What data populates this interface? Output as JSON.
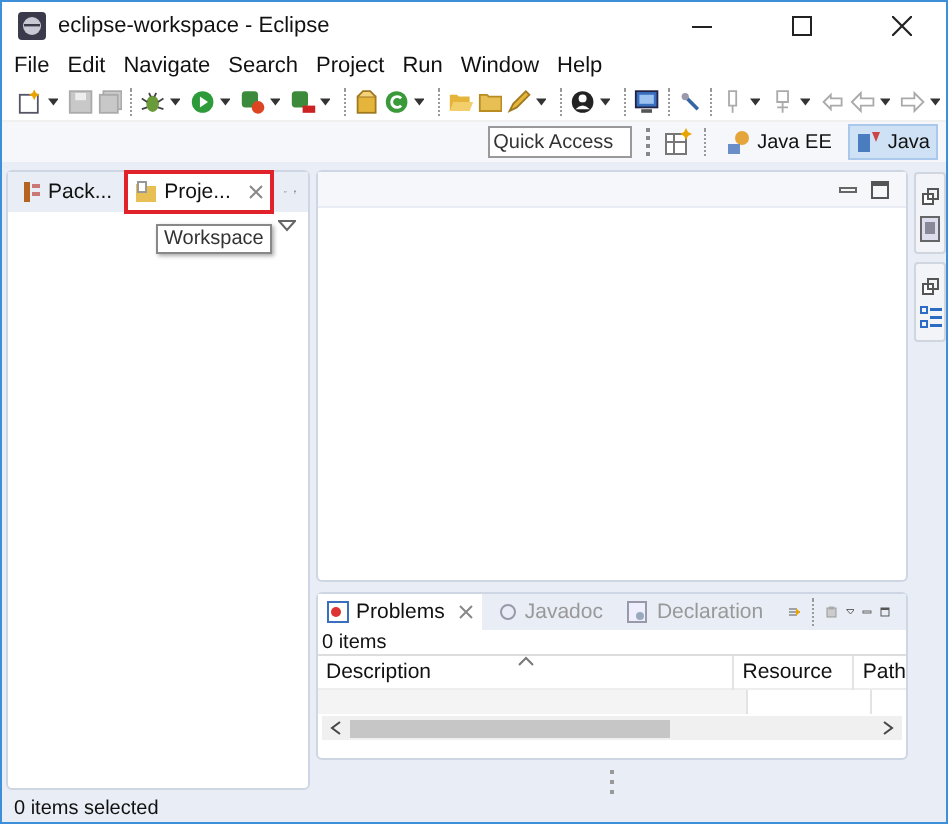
{
  "window": {
    "title": "eclipse-workspace - Eclipse"
  },
  "menu": [
    "File",
    "Edit",
    "Navigate",
    "Search",
    "Project",
    "Run",
    "Window",
    "Help"
  ],
  "perspective_bar": {
    "quick_access": {
      "placeholder": "Quick Access"
    },
    "perspectives": [
      {
        "label": "Java EE",
        "selected": false
      },
      {
        "label": "Java",
        "selected": true
      }
    ]
  },
  "left_panel": {
    "tabs": [
      {
        "label": "Pack...",
        "selected": false,
        "highlighted": false
      },
      {
        "label": "Proje...",
        "selected": true,
        "highlighted": true
      }
    ],
    "tooltip": "Workspace"
  },
  "bottom_panel": {
    "tabs": [
      {
        "label": "Problems",
        "selected": true
      },
      {
        "label": "Javadoc",
        "selected": false
      },
      {
        "label": "Declaration",
        "selected": false
      }
    ],
    "summary": "0 items",
    "table": {
      "columns": [
        "Description",
        "Resource",
        "Path"
      ]
    }
  },
  "status_bar": "0 items selected"
}
